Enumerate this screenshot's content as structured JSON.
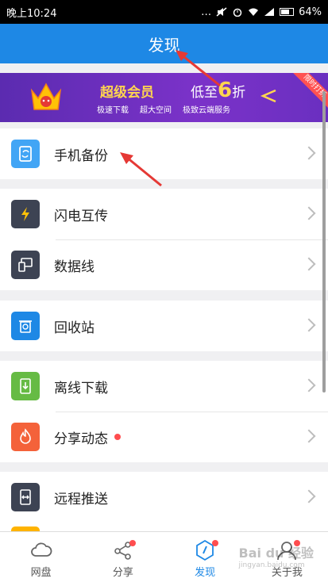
{
  "status": {
    "time": "晚上10:24",
    "battery": "64%"
  },
  "header": {
    "title": "发现"
  },
  "banner": {
    "title": "超级会员",
    "discount_prefix": "低至",
    "discount_num": "6",
    "discount_suffix": "折",
    "features": [
      "极速下载",
      "超大空间",
      "极致云端服务"
    ],
    "ribbon": "限时打折"
  },
  "sections": [
    {
      "items": [
        {
          "label": "手机备份",
          "icon": "phone-backup-icon",
          "color": "#42a5f5"
        }
      ]
    },
    {
      "items": [
        {
          "label": "闪电互传",
          "icon": "lightning-icon",
          "color": "#3d4353"
        },
        {
          "label": "数据线",
          "icon": "data-cable-icon",
          "color": "#3d4353"
        }
      ]
    },
    {
      "items": [
        {
          "label": "回收站",
          "icon": "recycle-bin-icon",
          "color": "#1e88e5"
        }
      ]
    },
    {
      "items": [
        {
          "label": "离线下载",
          "icon": "offline-download-icon",
          "color": "#66bb44"
        },
        {
          "label": "分享动态",
          "icon": "flame-icon",
          "color": "#f4623a",
          "badge": true
        }
      ]
    },
    {
      "items": [
        {
          "label": "远程推送",
          "icon": "remote-push-icon",
          "color": "#3d4353"
        }
      ]
    }
  ],
  "tabs": [
    {
      "label": "网盘",
      "icon": "cloud-icon",
      "badge": false,
      "active": false
    },
    {
      "label": "分享",
      "icon": "share-icon",
      "badge": true,
      "active": false
    },
    {
      "label": "发现",
      "icon": "compass-icon",
      "badge": true,
      "active": true
    },
    {
      "label": "关于我",
      "icon": "user-icon",
      "badge": true,
      "active": false
    }
  ],
  "watermark": {
    "text": "Bai du 经验",
    "sub": "jingyan.baidu.com"
  },
  "colors": {
    "primary": "#1e88e5",
    "badge": "#ff4d4f",
    "annotation": "#e53935"
  }
}
